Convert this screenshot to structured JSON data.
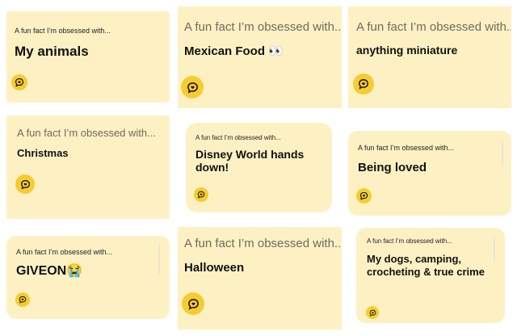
{
  "prompt_label": "A fun fact I’m obsessed with...",
  "colors": {
    "card_bg": "#fdf1c4",
    "icon_bg": "#f6cc2e",
    "icon_fg": "#111111"
  },
  "icon": "speech-bubble-heart-icon",
  "cards": [
    {
      "answer": "My animals"
    },
    {
      "answer": "Mexican Food 👀"
    },
    {
      "answer": "anything miniature"
    },
    {
      "answer": "Christmas"
    },
    {
      "answer": "Disney World hands down!"
    },
    {
      "answer": "Being loved"
    },
    {
      "answer": "GIVEON😭"
    },
    {
      "answer": "Halloween"
    },
    {
      "answer": "My dogs, camping, crocheting & true crime"
    }
  ]
}
